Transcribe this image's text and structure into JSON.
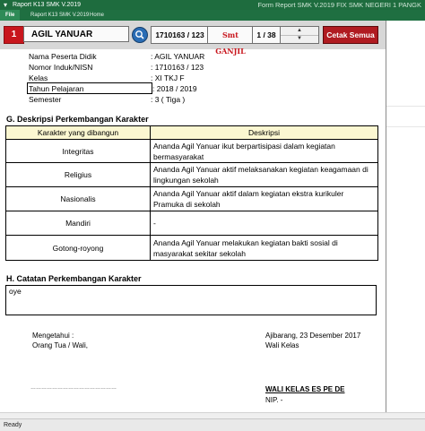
{
  "window": {
    "title": "Form Report SMK V.2019 FIX SMK NEGERI 1 PANGK",
    "quick_access": "Raport K13 SMK V.2019"
  },
  "ribbon": {
    "tabs": [
      "File",
      "Raport K13 SMK V.2019",
      "Home"
    ]
  },
  "header": {
    "number": "1",
    "student_name": "AGIL YANUAR",
    "student_id": "1710163 / 123",
    "semester": "Smt GANJIL",
    "page": "1 / 38",
    "print_label": "Cetak Semua"
  },
  "identity": {
    "rows": [
      {
        "label": "Nama Peserta Didik",
        "value": ": AGIL YANUAR"
      },
      {
        "label": "Nomor Induk/NISN",
        "value": ": 1710163 / 123"
      },
      {
        "label": "Kelas",
        "value": ": XI TKJ F"
      },
      {
        "label": "Tahun Pelajaran",
        "value": ": 2018 / 2019"
      },
      {
        "label": "Semester",
        "value": ": 3 ( Tiga )"
      }
    ]
  },
  "section_g": {
    "title": "G. Deskripsi Perkembangan Karakter",
    "col_karakter": "Karakter yang dibangun",
    "col_deskripsi": "Deskripsi",
    "rows": [
      {
        "karakter": "Integritas",
        "deskripsi": "Ananda Agil Yanuar ikut berpartisipasi dalam kegiatan bermasyarakat"
      },
      {
        "karakter": "Religius",
        "deskripsi": "Ananda Agil Yanuar aktif melaksanakan kegiatan keagamaan di lingkungan sekolah"
      },
      {
        "karakter": "Nasionalis",
        "deskripsi": "Ananda Agil Yanuar aktif dalam kegiatan ekstra kurikuler Pramuka di sekolah"
      },
      {
        "karakter": "Mandiri",
        "deskripsi": "-"
      },
      {
        "karakter": "Gotong-royong",
        "deskripsi": "Ananda Agil Yanuar melakukan kegiatan bakti sosial di masyarakat sekitar sekolah"
      }
    ]
  },
  "section_h": {
    "title": "H. Catatan Perkembangan Karakter",
    "note": "oye"
  },
  "signature": {
    "left_line1": "Mengetahui :",
    "left_line2": "Orang Tua / Wali,",
    "left_blank": "…………………………………………",
    "right_line1": "Ajibarang, 23 Desember 2017",
    "right_line2": "Wali Kelas",
    "teacher_name": "WALI KELAS ES PE DE",
    "nip": "NIP. -"
  },
  "status": {
    "text": "Ready"
  },
  "colors": {
    "titlebar": "#1e6c3e",
    "accent_red": "#c8161d",
    "table_header": "#fbf7d1"
  }
}
